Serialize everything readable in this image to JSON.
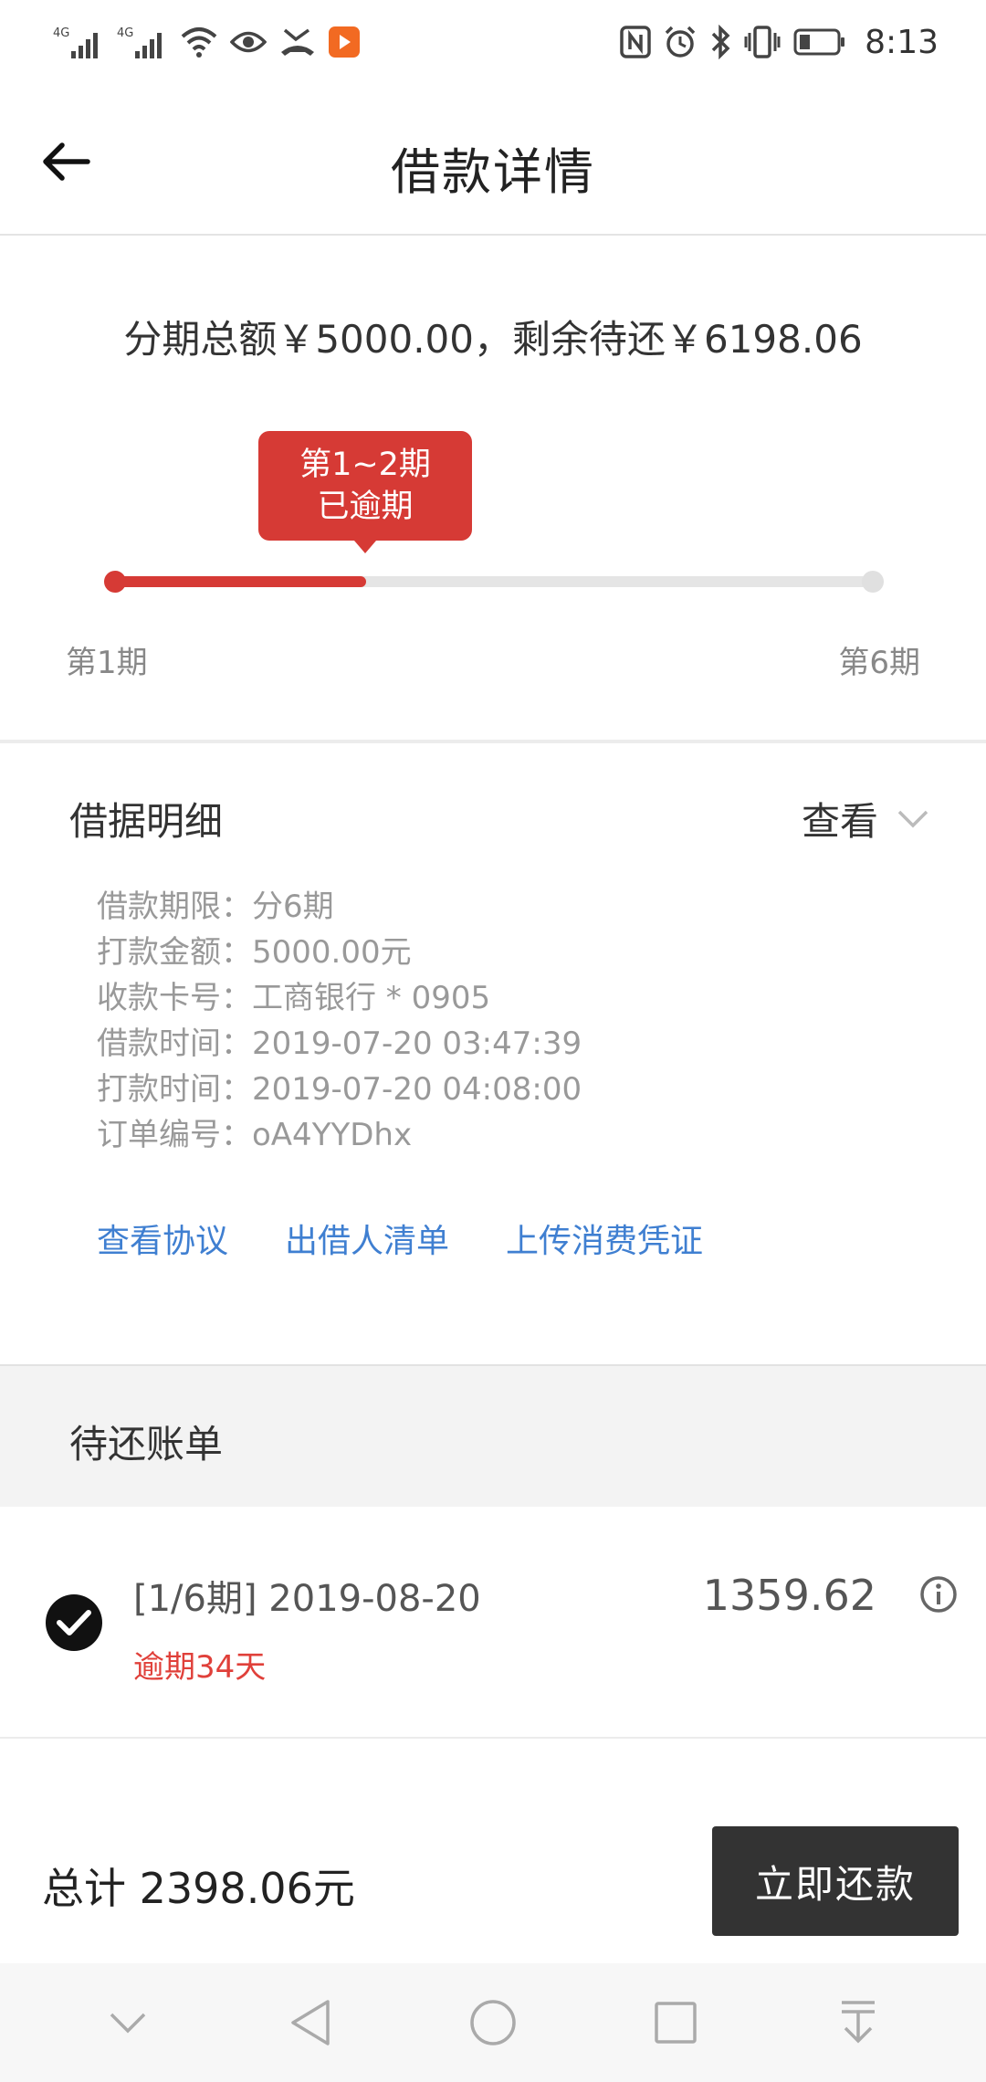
{
  "status_bar": {
    "signal1_label": "4G",
    "signal2_label": "4G",
    "time": "8:13",
    "icons_left": [
      "signal-icon",
      "signal-icon",
      "wifi-icon",
      "eye-icon",
      "missed-call-icon",
      "app-notification-icon"
    ],
    "icons_right": [
      "nfc-icon",
      "alarm-icon",
      "bluetooth-icon",
      "vibrate-icon",
      "battery-icon"
    ]
  },
  "nav": {
    "title": "借款详情"
  },
  "summary": {
    "text": "分期总额￥5000.00，剩余待还￥6198.06",
    "tooltip_line1": "第1~2期",
    "tooltip_line2": "已逾期",
    "start_label": "第1期",
    "end_label": "第6期",
    "progress_fraction": 0.333,
    "accent_color": "#d63a35"
  },
  "details": {
    "title": "借据明细",
    "toggle_label": "查看",
    "rows": [
      {
        "label": "借款期限：",
        "value": "分6期"
      },
      {
        "label": "打款金额：",
        "value": "5000.00元"
      },
      {
        "label": "收款卡号：",
        "value": "工商银行 * 0905"
      },
      {
        "label": "借款时间：",
        "value": "2019-07-20 03:47:39"
      },
      {
        "label": "打款时间：",
        "value": "2019-07-20 04:08:00"
      },
      {
        "label": "订单编号：",
        "value": "oA4YYDhx"
      }
    ],
    "links": [
      "查看协议",
      "出借人清单",
      "上传消费凭证"
    ],
    "link_color": "#3f7fd1"
  },
  "bills": {
    "title": "待还账单",
    "items": [
      {
        "period": "[1/6期] 2019-08-20",
        "status": "逾期34天",
        "amount": "1359.62",
        "checked": true
      }
    ]
  },
  "footer": {
    "total": "总计 2398.06元",
    "pay_label": "立即还款"
  }
}
